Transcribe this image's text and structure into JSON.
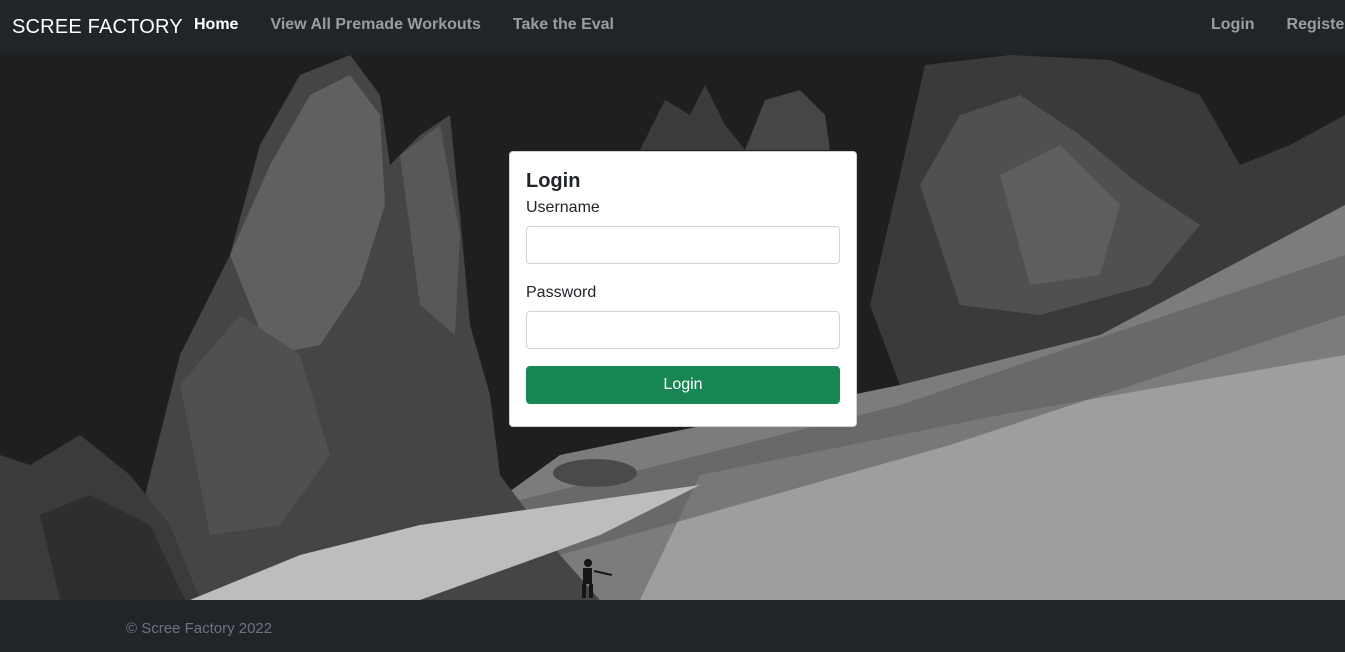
{
  "navbar": {
    "brand": "SCREE FACTORY",
    "links_left": [
      {
        "label": "Home",
        "active": true
      },
      {
        "label": "View All Premade Workouts",
        "active": false
      },
      {
        "label": "Take the Eval",
        "active": false
      }
    ],
    "links_right": [
      {
        "label": "Login"
      },
      {
        "label": "Register"
      }
    ]
  },
  "login_form": {
    "title": "Login",
    "username_label": "Username",
    "username_value": "",
    "password_label": "Password",
    "password_value": "",
    "submit_label": "Login"
  },
  "footer": {
    "copyright": "© Scree Factory 2022"
  },
  "colors": {
    "navbar_bg": "#212529",
    "button_green": "#198754"
  }
}
